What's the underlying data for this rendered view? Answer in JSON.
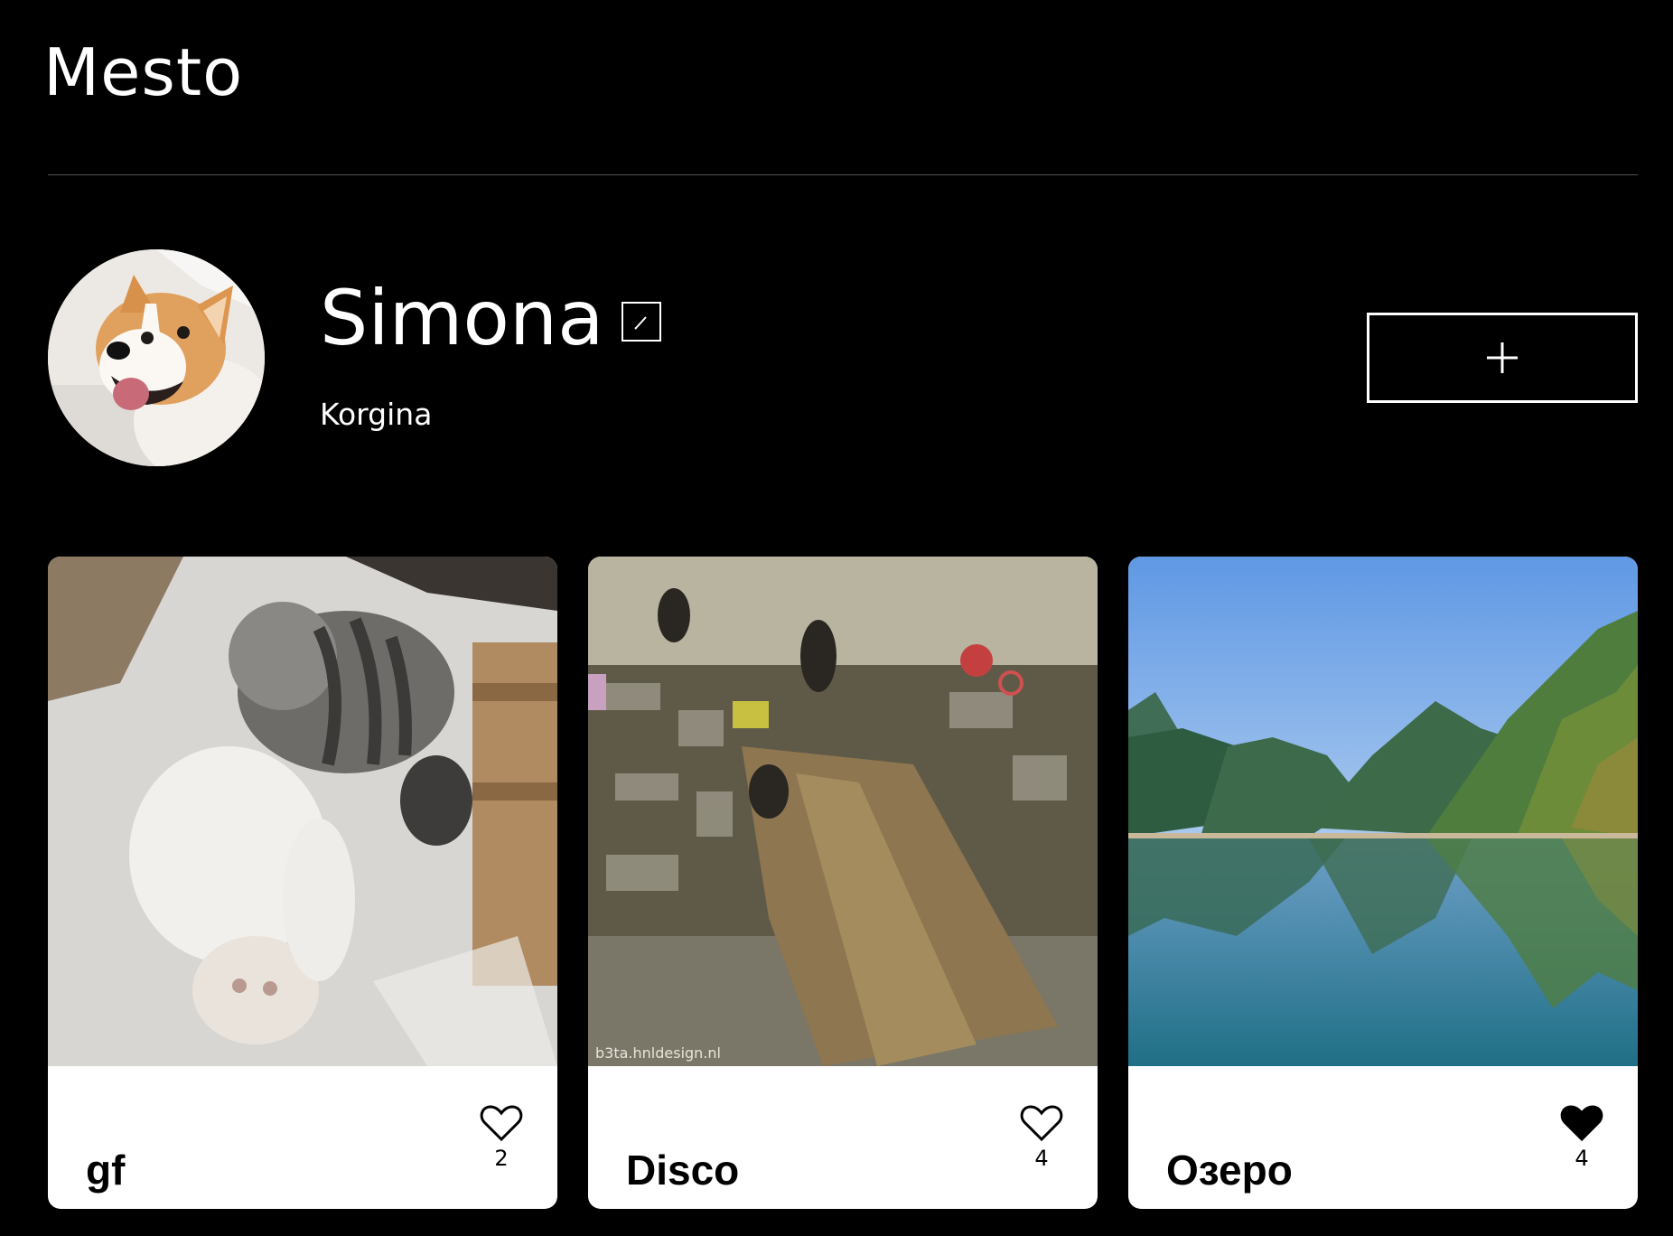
{
  "header": {
    "logo": "Mesto"
  },
  "profile": {
    "name": "Simona",
    "about": "Korgina",
    "avatar_icon": "corgi-avatar",
    "edit_icon": "pencil-icon",
    "add_icon": "plus-icon"
  },
  "cards": [
    {
      "title": "gf",
      "likes": "2",
      "liked": false,
      "image": "cats-playing"
    },
    {
      "title": "Disco",
      "likes": "4",
      "liked": false,
      "image": "disco-blur",
      "image_caption": "b3ta.hnldesign.nl"
    },
    {
      "title": "Озеро",
      "likes": "4",
      "liked": true,
      "image": "mountain-lake"
    }
  ],
  "colors": {
    "background": "#000000",
    "card": "#ffffff",
    "text_on_card": "#000000",
    "divider": "#545454"
  }
}
